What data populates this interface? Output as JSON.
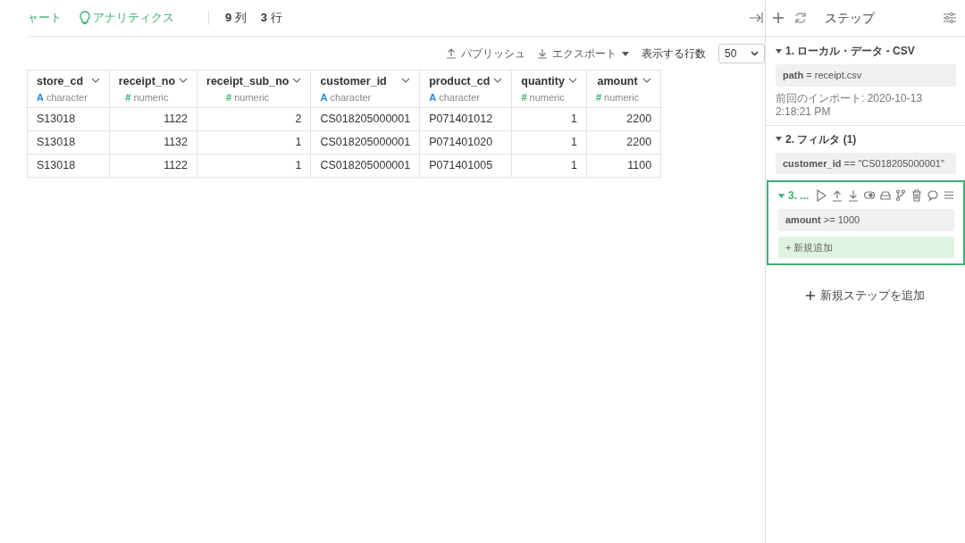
{
  "topbar": {
    "tabs": [
      {
        "label": "ャート",
        "icon": false
      },
      {
        "label": "アナリティクス",
        "icon": true
      }
    ],
    "counts": [
      {
        "value": "9",
        "unit": "列"
      },
      {
        "value": "3",
        "unit": "行"
      }
    ]
  },
  "toolbar": {
    "publish": "パブリッシュ",
    "export": "エクスポート",
    "rows_label": "表示する行数",
    "rows_value": "50"
  },
  "table": {
    "columns": [
      {
        "name": "store_cd",
        "kind": "character",
        "type_icon": "A",
        "type_label": "character"
      },
      {
        "name": "receipt_no",
        "kind": "numeric",
        "type_icon": "#",
        "type_label": "numeric"
      },
      {
        "name": "receipt_sub_no",
        "kind": "numeric",
        "type_icon": "#",
        "type_label": "numeric"
      },
      {
        "name": "customer_id",
        "kind": "character",
        "type_icon": "A",
        "type_label": "character"
      },
      {
        "name": "product_cd",
        "kind": "character",
        "type_icon": "A",
        "type_label": "character"
      },
      {
        "name": "quantity",
        "kind": "numeric",
        "type_icon": "#",
        "type_label": "numeric"
      },
      {
        "name": "amount",
        "kind": "numeric",
        "type_icon": "#",
        "type_label": "numeric"
      }
    ],
    "rows": [
      [
        "S13018",
        "1122",
        "2",
        "CS018205000001",
        "P071401012",
        "1",
        "2200"
      ],
      [
        "S13018",
        "1132",
        "1",
        "CS018205000001",
        "P071401020",
        "1",
        "2200"
      ],
      [
        "S13018",
        "1122",
        "1",
        "CS018205000001",
        "P071401005",
        "1",
        "1100"
      ]
    ]
  },
  "steps_panel": {
    "title": "ステップ",
    "steps": [
      {
        "title": "1. ローカル・データ - CSV",
        "selected": false,
        "expanded": true,
        "conditions": [
          "**path** = receipt.csv"
        ],
        "note": "前回のインポート: 2020-10-13 2:18:21 PM"
      },
      {
        "title": "2. フィルタ (1)",
        "selected": false,
        "expanded": true,
        "conditions": [
          "**customer_id** == \"CS018205000001\""
        ]
      },
      {
        "title": "3. ...",
        "selected": true,
        "expanded": true,
        "conditions": [
          "**amount** >= 1000"
        ],
        "add_label": "+ 新規追加"
      }
    ],
    "add_step": "新規ステップを追加"
  }
}
